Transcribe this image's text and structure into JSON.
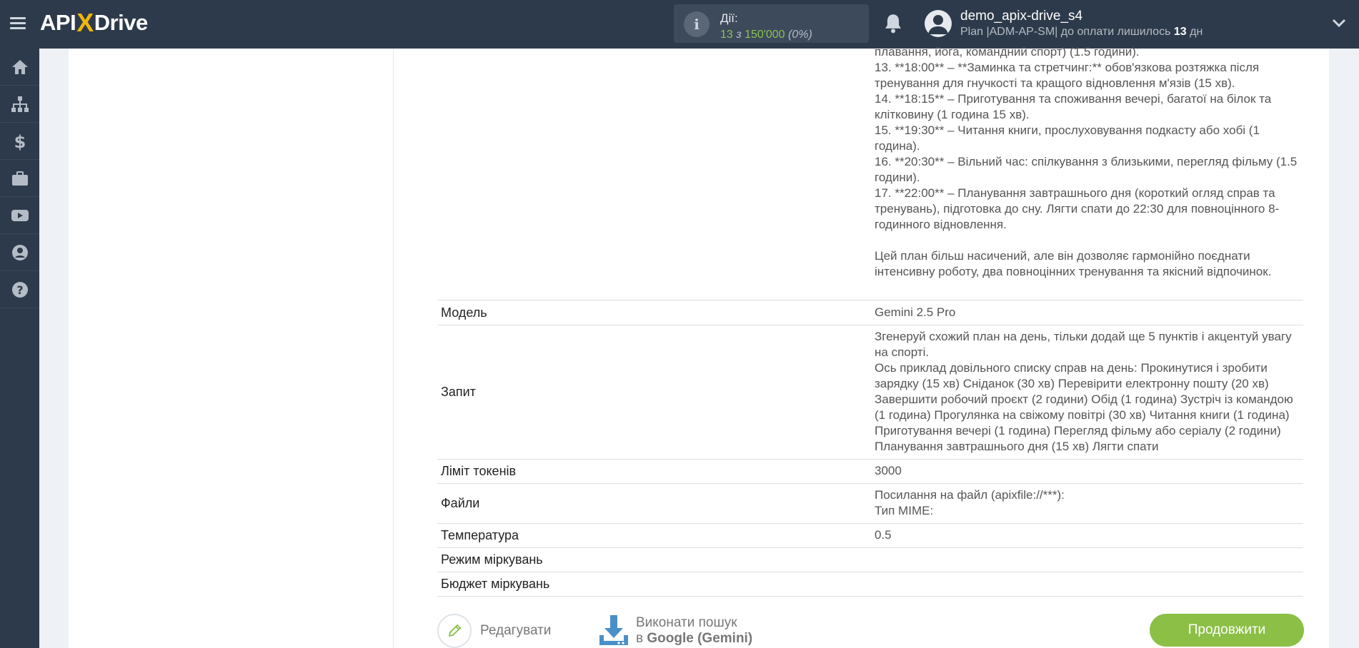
{
  "header": {
    "logo_api": "API",
    "logo_x": "X",
    "logo_drive": "Drive",
    "actions_label": "Дії:",
    "actions_count": "13",
    "actions_sep": " з ",
    "actions_total": "150'000",
    "actions_pct": "(0%)",
    "username": "demo_apix-drive_s4",
    "plan_text": "Plan |ADM-AP-SM| до оплати лишилось ",
    "plan_days": "13",
    "plan_unit": " дн"
  },
  "sidebar": {
    "items": [
      "home-icon",
      "sitemap-icon",
      "dollar-icon",
      "briefcase-icon",
      "youtube-icon",
      "user-circle-icon",
      "question-circle-icon"
    ]
  },
  "response_text": "плавання, йога, командний спорт) (1.5 години).\n13. **18:00** – **Заминка та стретчинг:** обов'язкова розтяжка після тренування для гнучкості та кращого відновлення м'язів (15 хв).\n14. **18:15** – Приготування та споживання вечері, багатої на білок та клітковину (1 година 15 хв).\n15. **19:30** – Читання книги, прослуховування подкасту або хобі (1 година).\n16. **20:30** – Вільний час: спілкування з близькими, перегляд фільму (1.5 години).\n17. **22:00** – Планування завтрашнього дня (короткий огляд справ та тренувань), підготовка до сну. Лягти спати до 22:30 для повноцінного 8-годинного відновлення.\n\nЦей план більш насичений, але він дозволяє гармонійно поєднати інтенсивну роботу, два повноцінних тренування та якісний відпочинок.",
  "rows": {
    "model": {
      "key": "Модель",
      "value": "Gemini 2.5 Pro"
    },
    "query": {
      "key": "Запит",
      "value": "Згенеруй схожий план на день, тільки додай ще 5 пунктів і акцентуй увагу на спорті.\nОсь приклад довільного списку справ на день: Прокинутися і зробити зарядку (15 хв) Сніданок (30 хв) Перевірити електронну пошту (20 хв) Завершити робочий проєкт (2 години) Обід (1 година) Зустріч із командою (1 година) Прогулянка на свіжому повітрі (30 хв) Читання книги (1 година) Приготування вечері (1 година) Перегляд фільму або серіалу (2 години) Планування завтрашнього дня (15 хв) Лягти спати"
    },
    "tokens": {
      "key": "Ліміт токенів",
      "value": "3000"
    },
    "files": {
      "key": "Файли",
      "value": "Посилання на файл (apixfile://***):\nТип MIME:"
    },
    "temperature": {
      "key": "Температура",
      "value": "0.5"
    },
    "reasoning_mode": {
      "key": "Режим міркувань",
      "value": ""
    },
    "reasoning_budget": {
      "key": "Бюджет міркувань",
      "value": ""
    }
  },
  "footer": {
    "edit_label": "Редагувати",
    "search_line1": "Виконати пошук",
    "search_line2_prefix": "в ",
    "search_line2_bold": "Google (Gemini)",
    "continue_label": "Продовжити"
  },
  "colors": {
    "topbar": "#2d3a4b",
    "accent_green": "#8bbf45",
    "logo_x": "#f2b707"
  }
}
